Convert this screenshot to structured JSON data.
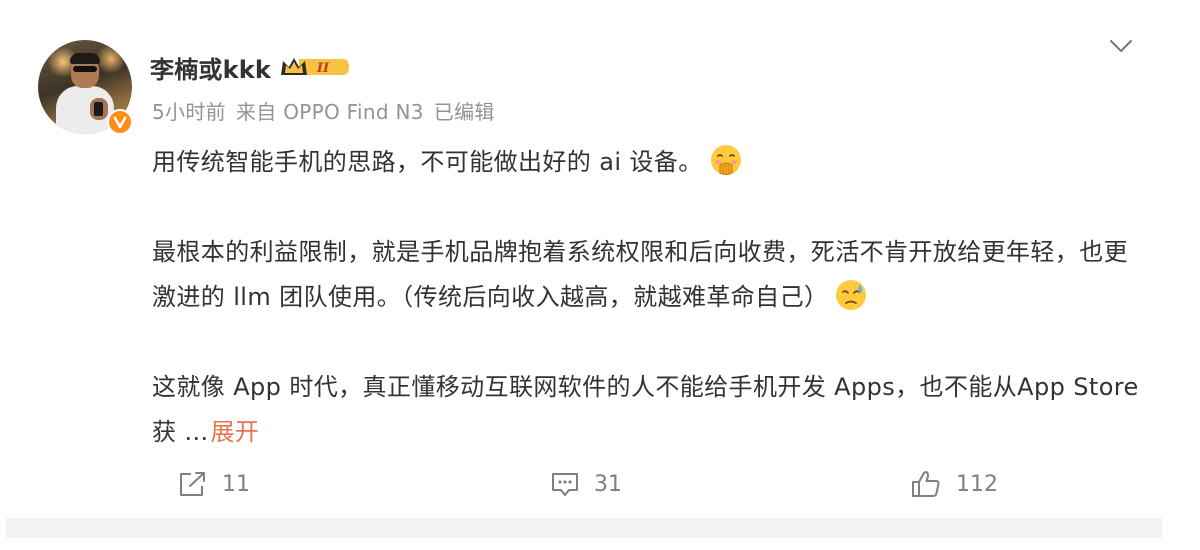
{
  "post": {
    "author": {
      "name": "李楠或kkk",
      "level_badge": "II",
      "verified_icon": "orange-verified-v-icon"
    },
    "meta": {
      "time": "5小时前",
      "source": "来自 OPPO Find N3",
      "edited": "已编辑"
    },
    "paragraphs": [
      {
        "text": "用传统智能手机的思路，不可能做出好的 ai 设备。",
        "emoji": "hand-over-mouth-emoji"
      },
      {
        "text": "最根本的利益限制，就是手机品牌抱着系统权限和后向收费，死活不肯开放给更年轻，也更激进的 llm 团队使用。（传统后向收入越高，就越难革命自己）",
        "emoji": "sweat-face-emoji"
      },
      {
        "text": "这就像 App 时代，真正懂移动互联网软件的人不能给手机开发 Apps，也不能从App Store 获 ",
        "ellipsis": "...",
        "expand_label": "展开"
      }
    ]
  },
  "actions": {
    "share_count": "11",
    "comment_count": "31",
    "like_count": "112"
  },
  "colors": {
    "text": "#333333",
    "meta": "#939393",
    "expand_link": "#eb7350",
    "verified": "#ff8c16",
    "badge_gold": "#f5c242"
  }
}
